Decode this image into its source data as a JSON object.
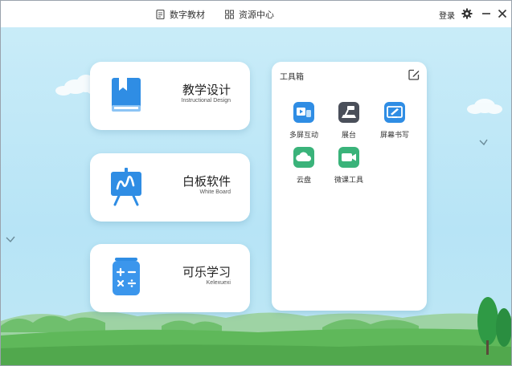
{
  "header": {
    "tabs": [
      {
        "label": "数字教材",
        "icon": "book-icon"
      },
      {
        "label": "资源中心",
        "icon": "grid-icon"
      }
    ],
    "login_label": "登录"
  },
  "cards": [
    {
      "title": "教学设计",
      "subtitle": "Instructional Design",
      "icon": "bookmark-book-icon"
    },
    {
      "title": "白板软件",
      "subtitle": "White Board",
      "icon": "easel-board-icon"
    },
    {
      "title": "可乐学习",
      "subtitle": "Kelexuexi",
      "icon": "calculator-can-icon"
    }
  ],
  "toolbox": {
    "title": "工具箱",
    "tools": [
      {
        "label": "多屏互动",
        "icon": "multi-screen-icon"
      },
      {
        "label": "展台",
        "icon": "document-camera-icon"
      },
      {
        "label": "屏幕书写",
        "icon": "screen-write-icon"
      },
      {
        "label": "云盘",
        "icon": "cloud-icon"
      },
      {
        "label": "微课工具",
        "icon": "video-camera-icon"
      }
    ]
  },
  "colors": {
    "sky": "#c1e8f7",
    "card_icon_blue": "#2f8de4",
    "grass": "#5fb85a",
    "tool_blue": "#2f8de4",
    "tool_dark": "#4a4f5a",
    "tool_green": "#3ab37a"
  }
}
